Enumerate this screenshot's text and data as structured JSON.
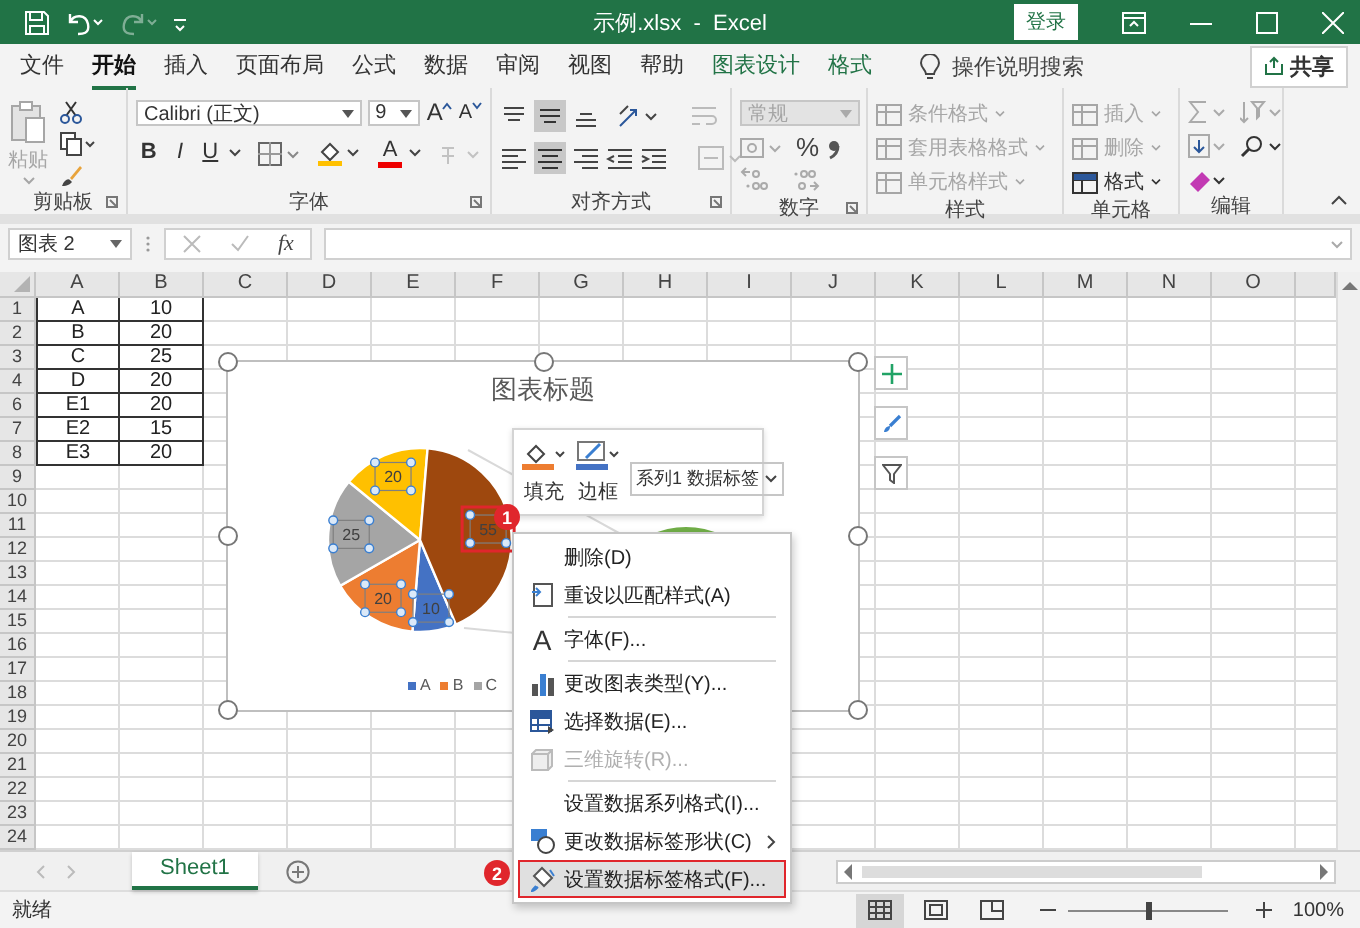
{
  "title_bar": {
    "title": "示例.xlsx  -  Excel",
    "login": "登录"
  },
  "ribbon_tabs": [
    {
      "label": "文件",
      "selected": false,
      "kind": "normal"
    },
    {
      "label": "开始",
      "selected": true,
      "kind": "normal"
    },
    {
      "label": "插入",
      "selected": false,
      "kind": "normal"
    },
    {
      "label": "页面布局",
      "selected": false,
      "kind": "normal"
    },
    {
      "label": "公式",
      "selected": false,
      "kind": "normal"
    },
    {
      "label": "数据",
      "selected": false,
      "kind": "normal"
    },
    {
      "label": "审阅",
      "selected": false,
      "kind": "normal"
    },
    {
      "label": "视图",
      "selected": false,
      "kind": "normal"
    },
    {
      "label": "帮助",
      "selected": false,
      "kind": "normal"
    },
    {
      "label": "图表设计",
      "selected": false,
      "kind": "contextual"
    },
    {
      "label": "格式",
      "selected": false,
      "kind": "contextual"
    }
  ],
  "tell_me": "操作说明搜索",
  "share": "共享",
  "ribbon": {
    "clipboard": {
      "label": "剪贴板",
      "paste": {
        "label": "粘贴",
        "disabled": true
      }
    },
    "font": {
      "label": "字体",
      "font_name": "Calibri (正文)",
      "font_size": "9",
      "grow": "A",
      "shrink": "A",
      "bold": "B",
      "italic": "I",
      "underline": "U",
      "font_color": "A"
    },
    "alignment": {
      "label": "对齐方式"
    },
    "number": {
      "label": "数字",
      "format": {
        "value": "常规",
        "disabled": true
      },
      "percent": "%"
    },
    "styles": {
      "label": "样式",
      "items": [
        {
          "label": "条件格式",
          "disabled": true
        },
        {
          "label": "套用表格格式",
          "disabled": true
        },
        {
          "label": "单元格样式",
          "disabled": true
        }
      ]
    },
    "cells": {
      "label": "单元格",
      "items": [
        {
          "label": "插入",
          "disabled": true
        },
        {
          "label": "删除",
          "disabled": true
        },
        {
          "label": "格式",
          "disabled": false
        }
      ]
    },
    "editing": {
      "label": "编辑"
    }
  },
  "formula_bar": {
    "name_box": "图表 2",
    "function_label": "fx"
  },
  "columns": [
    "A",
    "B",
    "C",
    "D",
    "E",
    "F",
    "G",
    "H",
    "I",
    "J",
    "K",
    "L",
    "M",
    "N",
    "O"
  ],
  "rows": [
    {
      "header": "1",
      "cells": [
        "A",
        "10"
      ]
    },
    {
      "header": "2",
      "cells": [
        "B",
        "20"
      ]
    },
    {
      "header": "3",
      "cells": [
        "C",
        "25"
      ]
    },
    {
      "header": "4",
      "cells": [
        "D",
        "20"
      ]
    },
    {
      "header": "6",
      "cells": [
        "E1",
        "20"
      ]
    },
    {
      "header": "7",
      "cells": [
        "E2",
        "15"
      ]
    },
    {
      "header": "8",
      "cells": [
        "E3",
        "20"
      ]
    },
    {
      "header": "9",
      "cells": []
    },
    {
      "header": "10",
      "cells": []
    },
    {
      "header": "11",
      "cells": []
    },
    {
      "header": "12",
      "cells": []
    },
    {
      "header": "13",
      "cells": []
    },
    {
      "header": "14",
      "cells": []
    },
    {
      "header": "15",
      "cells": []
    },
    {
      "header": "16",
      "cells": []
    },
    {
      "header": "17",
      "cells": []
    },
    {
      "header": "18",
      "cells": []
    },
    {
      "header": "19",
      "cells": []
    },
    {
      "header": "20",
      "cells": []
    },
    {
      "header": "21",
      "cells": []
    },
    {
      "header": "22",
      "cells": []
    },
    {
      "header": "23",
      "cells": []
    },
    {
      "header": "24",
      "cells": []
    }
  ],
  "chart": {
    "chart_data": {
      "type": "pie",
      "title": "图表标题",
      "values": [
        10,
        20,
        25,
        20,
        55
      ],
      "data_labels": true
    },
    "legend": [
      {
        "label": "A",
        "color": "#4472c4"
      },
      {
        "label": "B",
        "color": "#ed7d31"
      },
      {
        "label": "C",
        "color": "#a5a5a5"
      }
    ],
    "highlight_label": true,
    "badge": "1"
  },
  "mini_toolbar": {
    "fill": "填充",
    "border": "边框",
    "element_select": "系列1 数据标签"
  },
  "context_menu": {
    "badge": "2",
    "items": [
      {
        "label": "删除(D)",
        "kind": "plain",
        "disabled": false,
        "selected": false,
        "divider": false
      },
      {
        "label": "重设以匹配样式(A)",
        "kind": "reset",
        "disabled": false,
        "selected": false,
        "divider": false
      },
      {
        "label": "字体(F)...",
        "kind": "font",
        "glyph": "A",
        "disabled": false,
        "selected": false,
        "divider": true
      },
      {
        "label": "更改图表类型(Y)...",
        "kind": "charttype",
        "disabled": false,
        "selected": false,
        "divider": true
      },
      {
        "label": "选择数据(E)...",
        "kind": "data",
        "disabled": false,
        "selected": false,
        "divider": false
      },
      {
        "label": "三维旋转(R)...",
        "kind": "rotate",
        "disabled": true,
        "selected": false,
        "divider": false
      },
      {
        "label": "设置数据系列格式(I)...",
        "kind": "plain",
        "disabled": false,
        "selected": false,
        "divider": true
      },
      {
        "label": "更改数据标签形状(C)",
        "kind": "shape",
        "disabled": false,
        "selected": false,
        "divider": false
      },
      {
        "label": "设置数据标签格式(F)...",
        "kind": "format",
        "disabled": false,
        "selected": true,
        "divider": false
      }
    ]
  },
  "sheet_tabs": [
    {
      "label": "Sheet1",
      "selected": true
    }
  ],
  "status_bar": {
    "status": "就绪",
    "views": [
      {
        "kind": "normal",
        "selected": true
      },
      {
        "kind": "layout",
        "selected": false
      },
      {
        "kind": "pagebreak",
        "selected": false
      }
    ],
    "zoom_slider": {
      "level": 0.5
    },
    "zoom": "100%"
  }
}
